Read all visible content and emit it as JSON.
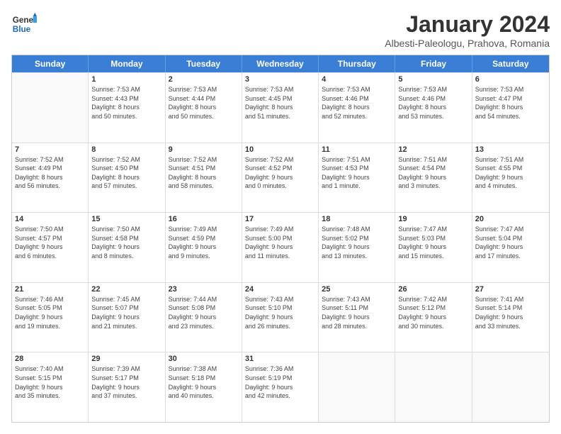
{
  "logo": {
    "line1": "General",
    "line2": "Blue"
  },
  "title": "January 2024",
  "subtitle": "Albesti-Paleologu, Prahova, Romania",
  "header_days": [
    "Sunday",
    "Monday",
    "Tuesday",
    "Wednesday",
    "Thursday",
    "Friday",
    "Saturday"
  ],
  "weeks": [
    [
      {
        "day": "",
        "info": ""
      },
      {
        "day": "1",
        "info": "Sunrise: 7:53 AM\nSunset: 4:43 PM\nDaylight: 8 hours\nand 50 minutes."
      },
      {
        "day": "2",
        "info": "Sunrise: 7:53 AM\nSunset: 4:44 PM\nDaylight: 8 hours\nand 50 minutes."
      },
      {
        "day": "3",
        "info": "Sunrise: 7:53 AM\nSunset: 4:45 PM\nDaylight: 8 hours\nand 51 minutes."
      },
      {
        "day": "4",
        "info": "Sunrise: 7:53 AM\nSunset: 4:46 PM\nDaylight: 8 hours\nand 52 minutes."
      },
      {
        "day": "5",
        "info": "Sunrise: 7:53 AM\nSunset: 4:46 PM\nDaylight: 8 hours\nand 53 minutes."
      },
      {
        "day": "6",
        "info": "Sunrise: 7:53 AM\nSunset: 4:47 PM\nDaylight: 8 hours\nand 54 minutes."
      }
    ],
    [
      {
        "day": "7",
        "info": "Sunrise: 7:52 AM\nSunset: 4:49 PM\nDaylight: 8 hours\nand 56 minutes."
      },
      {
        "day": "8",
        "info": "Sunrise: 7:52 AM\nSunset: 4:50 PM\nDaylight: 8 hours\nand 57 minutes."
      },
      {
        "day": "9",
        "info": "Sunrise: 7:52 AM\nSunset: 4:51 PM\nDaylight: 8 hours\nand 58 minutes."
      },
      {
        "day": "10",
        "info": "Sunrise: 7:52 AM\nSunset: 4:52 PM\nDaylight: 9 hours\nand 0 minutes."
      },
      {
        "day": "11",
        "info": "Sunrise: 7:51 AM\nSunset: 4:53 PM\nDaylight: 9 hours\nand 1 minute."
      },
      {
        "day": "12",
        "info": "Sunrise: 7:51 AM\nSunset: 4:54 PM\nDaylight: 9 hours\nand 3 minutes."
      },
      {
        "day": "13",
        "info": "Sunrise: 7:51 AM\nSunset: 4:55 PM\nDaylight: 9 hours\nand 4 minutes."
      }
    ],
    [
      {
        "day": "14",
        "info": "Sunrise: 7:50 AM\nSunset: 4:57 PM\nDaylight: 9 hours\nand 6 minutes."
      },
      {
        "day": "15",
        "info": "Sunrise: 7:50 AM\nSunset: 4:58 PM\nDaylight: 9 hours\nand 8 minutes."
      },
      {
        "day": "16",
        "info": "Sunrise: 7:49 AM\nSunset: 4:59 PM\nDaylight: 9 hours\nand 9 minutes."
      },
      {
        "day": "17",
        "info": "Sunrise: 7:49 AM\nSunset: 5:00 PM\nDaylight: 9 hours\nand 11 minutes."
      },
      {
        "day": "18",
        "info": "Sunrise: 7:48 AM\nSunset: 5:02 PM\nDaylight: 9 hours\nand 13 minutes."
      },
      {
        "day": "19",
        "info": "Sunrise: 7:47 AM\nSunset: 5:03 PM\nDaylight: 9 hours\nand 15 minutes."
      },
      {
        "day": "20",
        "info": "Sunrise: 7:47 AM\nSunset: 5:04 PM\nDaylight: 9 hours\nand 17 minutes."
      }
    ],
    [
      {
        "day": "21",
        "info": "Sunrise: 7:46 AM\nSunset: 5:05 PM\nDaylight: 9 hours\nand 19 minutes."
      },
      {
        "day": "22",
        "info": "Sunrise: 7:45 AM\nSunset: 5:07 PM\nDaylight: 9 hours\nand 21 minutes."
      },
      {
        "day": "23",
        "info": "Sunrise: 7:44 AM\nSunset: 5:08 PM\nDaylight: 9 hours\nand 23 minutes."
      },
      {
        "day": "24",
        "info": "Sunrise: 7:43 AM\nSunset: 5:10 PM\nDaylight: 9 hours\nand 26 minutes."
      },
      {
        "day": "25",
        "info": "Sunrise: 7:43 AM\nSunset: 5:11 PM\nDaylight: 9 hours\nand 28 minutes."
      },
      {
        "day": "26",
        "info": "Sunrise: 7:42 AM\nSunset: 5:12 PM\nDaylight: 9 hours\nand 30 minutes."
      },
      {
        "day": "27",
        "info": "Sunrise: 7:41 AM\nSunset: 5:14 PM\nDaylight: 9 hours\nand 33 minutes."
      }
    ],
    [
      {
        "day": "28",
        "info": "Sunrise: 7:40 AM\nSunset: 5:15 PM\nDaylight: 9 hours\nand 35 minutes."
      },
      {
        "day": "29",
        "info": "Sunrise: 7:39 AM\nSunset: 5:17 PM\nDaylight: 9 hours\nand 37 minutes."
      },
      {
        "day": "30",
        "info": "Sunrise: 7:38 AM\nSunset: 5:18 PM\nDaylight: 9 hours\nand 40 minutes."
      },
      {
        "day": "31",
        "info": "Sunrise: 7:36 AM\nSunset: 5:19 PM\nDaylight: 9 hours\nand 42 minutes."
      },
      {
        "day": "",
        "info": ""
      },
      {
        "day": "",
        "info": ""
      },
      {
        "day": "",
        "info": ""
      }
    ]
  ]
}
